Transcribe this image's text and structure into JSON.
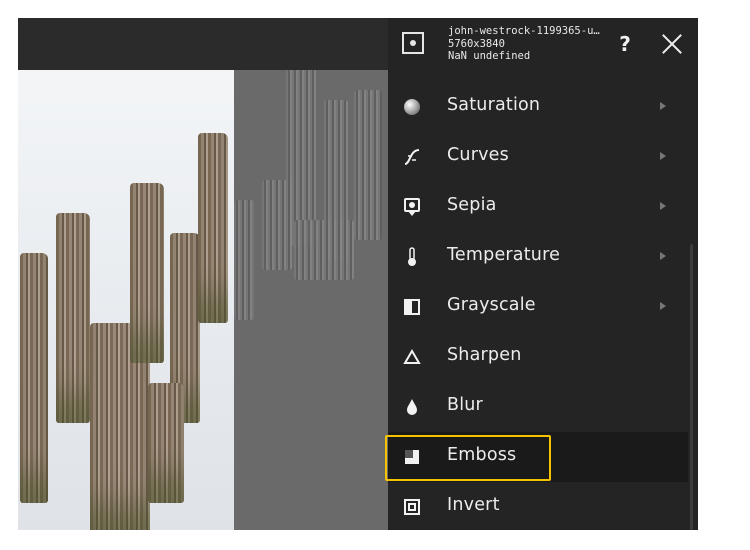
{
  "file": {
    "name": "john-westrock-1199365-u…",
    "dimensions": "5760x3840",
    "meta": "NaN undefined"
  },
  "header": {
    "help_label": "?"
  },
  "menu": {
    "items": [
      {
        "label": "Saturation",
        "icon": "saturation-icon",
        "has_submenu": true
      },
      {
        "label": "Curves",
        "icon": "curves-icon",
        "has_submenu": true
      },
      {
        "label": "Sepia",
        "icon": "sepia-icon",
        "has_submenu": true
      },
      {
        "label": "Temperature",
        "icon": "temperature-icon",
        "has_submenu": true
      },
      {
        "label": "Grayscale",
        "icon": "grayscale-icon",
        "has_submenu": true
      },
      {
        "label": "Sharpen",
        "icon": "sharpen-icon",
        "has_submenu": false
      },
      {
        "label": "Blur",
        "icon": "blur-icon",
        "has_submenu": false
      },
      {
        "label": "Emboss",
        "icon": "emboss-icon",
        "has_submenu": false,
        "selected": true
      },
      {
        "label": "Invert",
        "icon": "invert-icon",
        "has_submenu": false
      }
    ]
  },
  "colors": {
    "highlight": "#f5c400",
    "panel": "#242424",
    "text": "#ececec"
  }
}
